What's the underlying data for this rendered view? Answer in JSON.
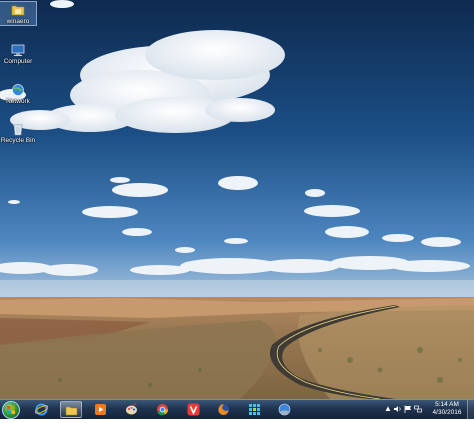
{
  "desktop": {
    "icons": [
      {
        "label": "winaero",
        "icon": "folder-icon"
      },
      {
        "label": "Computer",
        "icon": "computer-icon"
      },
      {
        "label": "Network",
        "icon": "network-icon"
      },
      {
        "label": "Recycle Bin",
        "icon": "recycle-bin-icon"
      }
    ]
  },
  "taskbar": {
    "pinned": [
      {
        "name": "internet-explorer",
        "icon": "ie-icon",
        "active": false
      },
      {
        "name": "explorer",
        "icon": "explorer-folder-icon",
        "active": true
      },
      {
        "name": "media-player",
        "icon": "media-player-icon",
        "active": false
      },
      {
        "name": "paint",
        "icon": "paint-icon",
        "active": false
      },
      {
        "name": "chrome",
        "icon": "chrome-icon",
        "active": false
      },
      {
        "name": "vivaldi",
        "icon": "vivaldi-icon",
        "active": false
      },
      {
        "name": "firefox",
        "icon": "firefox-icon",
        "active": false
      },
      {
        "name": "app-grid",
        "icon": "grid-app-icon",
        "active": false
      },
      {
        "name": "network-app",
        "icon": "globe-app-icon",
        "active": false
      }
    ],
    "clock": {
      "time": "5:14 AM",
      "date": "4/30/2016"
    },
    "colors": {
      "bar": "#1f3350",
      "accent": "#6f8fb5"
    }
  }
}
